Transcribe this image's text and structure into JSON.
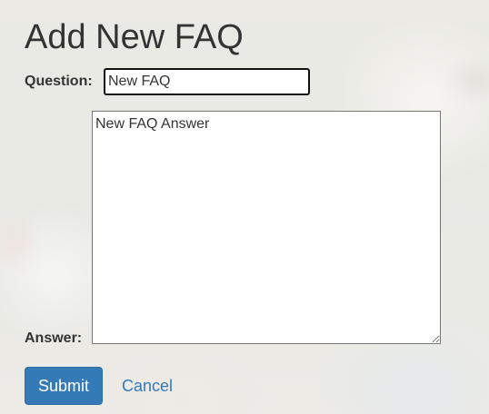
{
  "page": {
    "title": "Add New FAQ"
  },
  "form": {
    "question_label": "Question:",
    "question_value": "New FAQ",
    "answer_label": "Answer:",
    "answer_value": "New FAQ Answer",
    "submit_label": "Submit",
    "cancel_label": "Cancel"
  },
  "colors": {
    "primary": "#337ab7",
    "text": "#333333"
  }
}
